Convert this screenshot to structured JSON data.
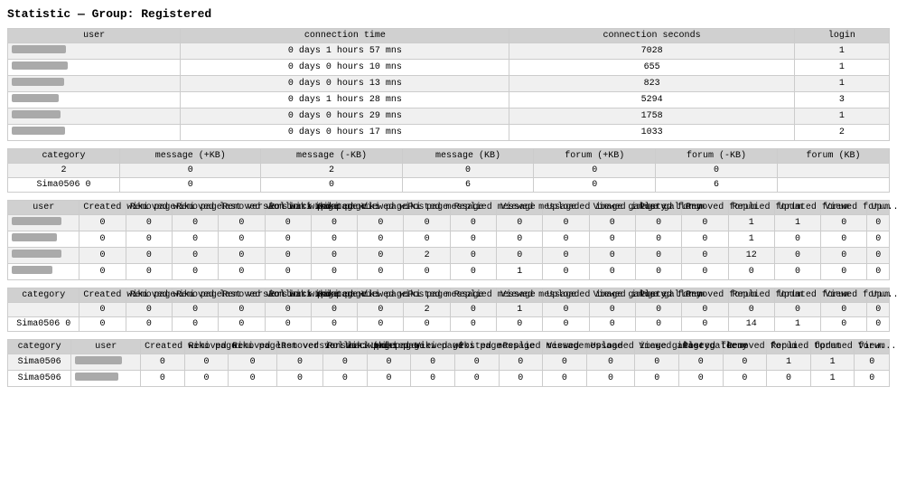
{
  "title": "Statistic — Group: Registered",
  "topTable": {
    "headers": [
      "user",
      "connection time",
      "connection seconds",
      "login"
    ],
    "rows": [
      {
        "user": "blurred1",
        "conn_time": "0 days 1 hours 57 mns",
        "conn_sec": "7028",
        "login": "1"
      },
      {
        "user": "blurred2",
        "conn_time": "0 days 0 hours 10 mns",
        "conn_sec": "655",
        "login": "1"
      },
      {
        "user": "blurred3",
        "conn_time": "0 days 0 hours 13 mns",
        "conn_sec": "823",
        "login": "1"
      },
      {
        "user": "blurred4",
        "conn_time": "0 days 1 hours 28 mns",
        "conn_sec": "5294",
        "login": "3"
      },
      {
        "user": "blurred5",
        "conn_time": "0 days 0 hours 29 mns",
        "conn_sec": "1758",
        "login": "1"
      },
      {
        "user": "blurred6",
        "conn_time": "0 days 0 hours 17 mns",
        "conn_sec": "1033",
        "login": "2"
      }
    ]
  },
  "midSummaryTable": {
    "headers": [
      "category",
      "message (+KB)",
      "message (-KB)",
      "message (KB)",
      "forum (+KB)",
      "forum (-KB)",
      "forum (KB)"
    ],
    "rows": [
      {
        "cat": "2",
        "msg_plus": "0",
        "msg_minus": "2",
        "msg_kb": "0",
        "forum_plus": "0",
        "forum_minus": "0",
        "forum_kb": ""
      },
      {
        "cat": "Sima0506 0",
        "msg_plus": "0",
        "msg_minus": "0",
        "msg_kb": "6",
        "forum_plus": "0",
        "forum_minus": "6",
        "forum_kb": ""
      }
    ]
  },
  "statsTable1": {
    "headers": [
      "user",
      "Created wiki page",
      "Removed wiki page",
      "Removed last version wiki page",
      "Removed version wiki page",
      "Rollback wiki page",
      "Updated wiki page",
      "Viewed wiki page",
      "Posted message",
      "Replied message",
      "Viewed message",
      "Uploaded image gallery",
      "Viewed image gallery",
      "Posted forum",
      "Removed forum",
      "Replied forum",
      "Updated forum",
      "Viewed forum",
      "Up..."
    ],
    "rows": [
      {
        "user": "b1",
        "vals": [
          "0",
          "0",
          "0",
          "0",
          "0",
          "0",
          "0",
          "0",
          "0",
          "0",
          "0",
          "0",
          "0",
          "0",
          "1",
          "1",
          "0",
          "0"
        ]
      },
      {
        "user": "b2",
        "vals": [
          "0",
          "0",
          "0",
          "0",
          "0",
          "0",
          "0",
          "0",
          "0",
          "0",
          "0",
          "0",
          "0",
          "0",
          "1",
          "0",
          "0",
          "0"
        ]
      },
      {
        "user": "b3",
        "vals": [
          "0",
          "0",
          "0",
          "0",
          "0",
          "0",
          "0",
          "2",
          "0",
          "0",
          "0",
          "0",
          "0",
          "0",
          "12",
          "0",
          "0",
          "0"
        ]
      },
      {
        "user": "b4",
        "vals": [
          "0",
          "0",
          "0",
          "0",
          "0",
          "0",
          "0",
          "0",
          "0",
          "1",
          "0",
          "0",
          "0",
          "0",
          "0",
          "0",
          "0",
          "0"
        ]
      }
    ]
  },
  "summaryRow1": {
    "category": "category",
    "headers": [
      "Created wiki page",
      "Removed wiki page",
      "Removed last version wiki page",
      "Removed version wiki page",
      "Rollback wiki page",
      "Updated wiki page",
      "Viewed wiki page",
      "Posted message",
      "Replied message",
      "Viewed message",
      "Uploaded image gallery",
      "Viewed image gallery",
      "Posted forum",
      "Removed forum",
      "Replied forum",
      "Updated forum",
      "Viewed forum",
      "Up..."
    ],
    "rows": [
      {
        "cat": "",
        "vals": [
          "0",
          "0",
          "0",
          "0",
          "0",
          "0",
          "0",
          "2",
          "0",
          "1",
          "0",
          "0",
          "0",
          "0",
          "0",
          "0",
          "0",
          "0"
        ]
      },
      {
        "cat": "Sima0506 0",
        "vals": [
          "0",
          "0",
          "0",
          "0",
          "0",
          "0",
          "0",
          "0",
          "0",
          "0",
          "0",
          "0",
          "0",
          "0",
          "14",
          "1",
          "0",
          "0"
        ]
      }
    ]
  },
  "bottomTable": {
    "headers": [
      "category",
      "user",
      "Created wiki page",
      "Removed wiki page",
      "Removed last version wiki page",
      "Removed version wiki page",
      "Rollback wiki page",
      "Updated wiki page",
      "Viewed wiki page",
      "Posted message",
      "Replied message",
      "Viewed message",
      "Uploaded image gallery",
      "Viewed image gallery",
      "Posted forum",
      "Removed forum",
      "Replied forum",
      "Updated forum",
      "View..."
    ],
    "rows": [
      {
        "cat": "Sima0506",
        "user": "b1",
        "vals": [
          "0",
          "0",
          "0",
          "0",
          "0",
          "0",
          "0",
          "0",
          "0",
          "0",
          "0",
          "0",
          "0",
          "0",
          "1",
          "1",
          "0"
        ]
      },
      {
        "cat": "Sima0506",
        "user": "b2",
        "vals": [
          "0",
          "0",
          "0",
          "0",
          "0",
          "0",
          "0",
          "0",
          "0",
          "0",
          "0",
          "0",
          "0",
          "0",
          "0",
          "1",
          "0"
        ]
      }
    ]
  }
}
